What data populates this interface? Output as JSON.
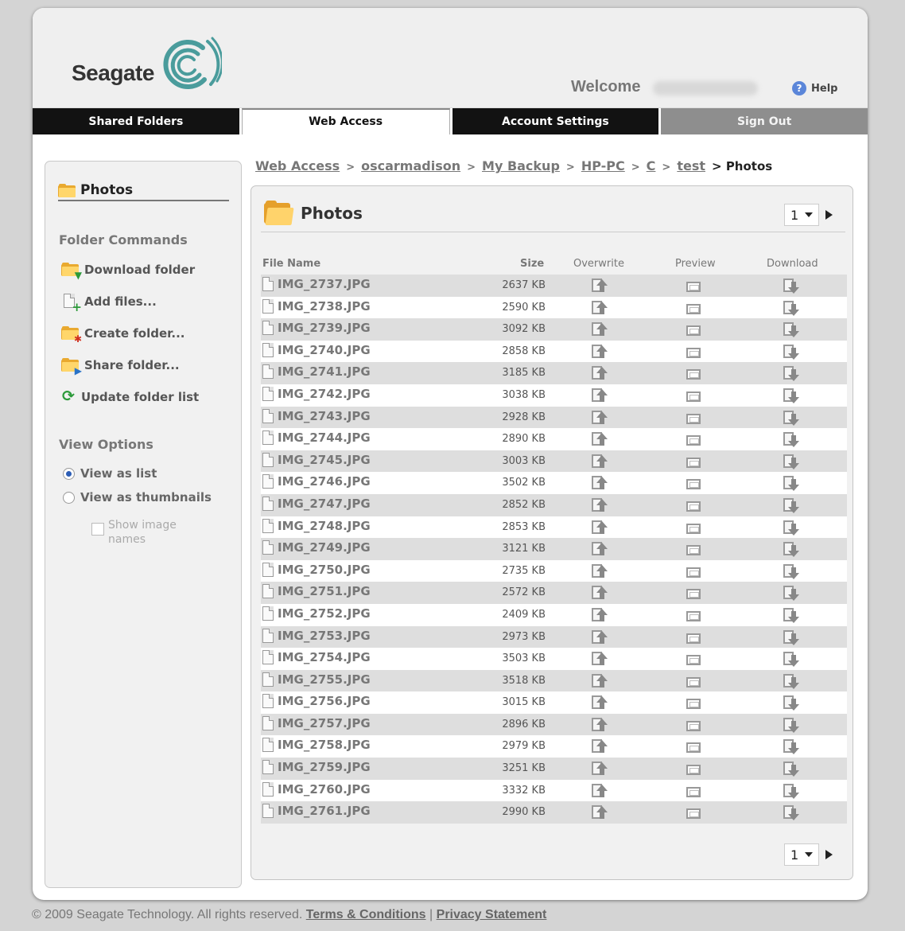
{
  "header": {
    "logo_text": "Seagate",
    "welcome_label": "Welcome",
    "help_label": "Help"
  },
  "nav": {
    "tabs": [
      "Shared Folders",
      "Web Access",
      "Account Settings",
      "Sign Out"
    ],
    "active": "Web Access"
  },
  "sidebar": {
    "title": "Photos",
    "folder_commands_heading": "Folder Commands",
    "commands": [
      "Download folder",
      "Add files...",
      "Create folder...",
      "Share folder...",
      "Update folder list"
    ],
    "view_options_heading": "View Options",
    "view_options": [
      "View as list",
      "View as thumbnails"
    ],
    "selected_view": "View as list",
    "show_names_label": "Show image names"
  },
  "breadcrumb": {
    "links": [
      "Web Access",
      "oscarmadison",
      "My Backup",
      "HP-PC",
      "C",
      "test"
    ],
    "separator": ">",
    "current": "Photos"
  },
  "panel": {
    "title": "Photos",
    "page": "1",
    "columns": {
      "name": "File Name",
      "size": "Size",
      "overwrite": "Overwrite",
      "preview": "Preview",
      "download": "Download"
    }
  },
  "files": [
    {
      "name": "IMG_2737.JPG",
      "size": "2637 KB"
    },
    {
      "name": "IMG_2738.JPG",
      "size": "2590 KB"
    },
    {
      "name": "IMG_2739.JPG",
      "size": "3092 KB"
    },
    {
      "name": "IMG_2740.JPG",
      "size": "2858 KB"
    },
    {
      "name": "IMG_2741.JPG",
      "size": "3185 KB"
    },
    {
      "name": "IMG_2742.JPG",
      "size": "3038 KB"
    },
    {
      "name": "IMG_2743.JPG",
      "size": "2928 KB"
    },
    {
      "name": "IMG_2744.JPG",
      "size": "2890 KB"
    },
    {
      "name": "IMG_2745.JPG",
      "size": "3003 KB"
    },
    {
      "name": "IMG_2746.JPG",
      "size": "3502 KB"
    },
    {
      "name": "IMG_2747.JPG",
      "size": "2852 KB"
    },
    {
      "name": "IMG_2748.JPG",
      "size": "2853 KB"
    },
    {
      "name": "IMG_2749.JPG",
      "size": "3121 KB"
    },
    {
      "name": "IMG_2750.JPG",
      "size": "2735 KB"
    },
    {
      "name": "IMG_2751.JPG",
      "size": "2572 KB"
    },
    {
      "name": "IMG_2752.JPG",
      "size": "2409 KB"
    },
    {
      "name": "IMG_2753.JPG",
      "size": "2973 KB"
    },
    {
      "name": "IMG_2754.JPG",
      "size": "3503 KB"
    },
    {
      "name": "IMG_2755.JPG",
      "size": "3518 KB"
    },
    {
      "name": "IMG_2756.JPG",
      "size": "3015 KB"
    },
    {
      "name": "IMG_2757.JPG",
      "size": "2896 KB"
    },
    {
      "name": "IMG_2758.JPG",
      "size": "2979 KB"
    },
    {
      "name": "IMG_2759.JPG",
      "size": "3251 KB"
    },
    {
      "name": "IMG_2760.JPG",
      "size": "3332 KB"
    },
    {
      "name": "IMG_2761.JPG",
      "size": "2990 KB"
    }
  ],
  "footer": {
    "copyright": "© 2009 Seagate Technology. All rights reserved.",
    "terms": "Terms & Conditions",
    "separator": "|",
    "privacy": "Privacy Statement"
  }
}
